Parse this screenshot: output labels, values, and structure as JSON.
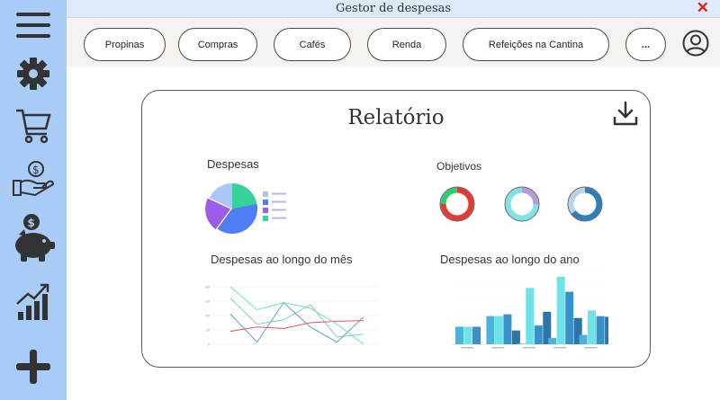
{
  "window": {
    "title": "Gestor de despesas",
    "close_label": "✕"
  },
  "sidebar": {
    "icons": [
      "menu-icon",
      "gear-icon",
      "cart-icon",
      "money-hand-icon",
      "piggy-bank-icon",
      "chart-growth-icon",
      "plus-icon"
    ]
  },
  "categories": [
    "Propinas",
    "Compras",
    "Cafés",
    "Renda",
    "Refeições na Cantina",
    "..."
  ],
  "report": {
    "title": "Relatório",
    "expenses_title": "Despesas",
    "goals_title": "Objetivos",
    "month_title": "Despesas ao longo do mês",
    "year_title": "Despesas ao longo do ano"
  },
  "colors": {
    "sidebar": "#a9ccf7",
    "titlebar": "#ddeaf9",
    "accent_red": "#e02020"
  },
  "chart_data": [
    {
      "type": "pie",
      "title": "Despesas",
      "slices": [
        0.22,
        0.38,
        0.22,
        0.18
      ],
      "colors": [
        "#34d399",
        "#4f7df3",
        "#9b5de5",
        "#a9c6f7"
      ]
    },
    {
      "type": "donut",
      "title": "Objetivos",
      "rings": [
        {
          "fraction": 0.75,
          "colors": [
            "#e53935",
            "#2ecc71"
          ]
        },
        {
          "fraction": 0.25,
          "colors": [
            "#b89bd6",
            "#7de3e8"
          ]
        },
        {
          "fraction": 0.65,
          "colors": [
            "#2f7fb6",
            "#b8d4ea"
          ]
        }
      ]
    },
    {
      "type": "line",
      "title": "Despesas ao longo do mês",
      "y_ticks": [
        "0",
        "20",
        "40",
        "60",
        "80"
      ],
      "ylim": [
        0,
        80
      ],
      "x": [
        1,
        2,
        3,
        4,
        5,
        6
      ],
      "series": [
        {
          "color": "#80c7c5",
          "values": [
            64,
            28,
            34,
            55,
            10,
            14
          ]
        },
        {
          "color": "#5fa0d6",
          "values": [
            42,
            3,
            58,
            24,
            3,
            38
          ]
        },
        {
          "color": "#e15759",
          "values": [
            18,
            24,
            22,
            30,
            32,
            33
          ]
        },
        {
          "color": "#6be2b5",
          "values": [
            80,
            48,
            58,
            50,
            28,
            0
          ]
        }
      ]
    },
    {
      "type": "bar",
      "title": "Despesas ao longo do ano",
      "categories": [
        "1",
        "2",
        "3",
        "4",
        "5"
      ],
      "series": [
        {
          "color": "#4bb3d7",
          "values": [
            28,
            45,
            1,
            10,
            15
          ]
        },
        {
          "color": "#6ce3e8",
          "values": [
            28,
            45,
            90,
            108,
            54
          ]
        },
        {
          "color": "#3a90c8",
          "values": [
            28,
            48,
            30,
            84,
            45
          ]
        },
        {
          "color": "#2d74a8",
          "values": [
            null,
            22,
            52,
            42,
            44
          ]
        }
      ],
      "ylim": [
        0,
        115
      ]
    }
  ]
}
